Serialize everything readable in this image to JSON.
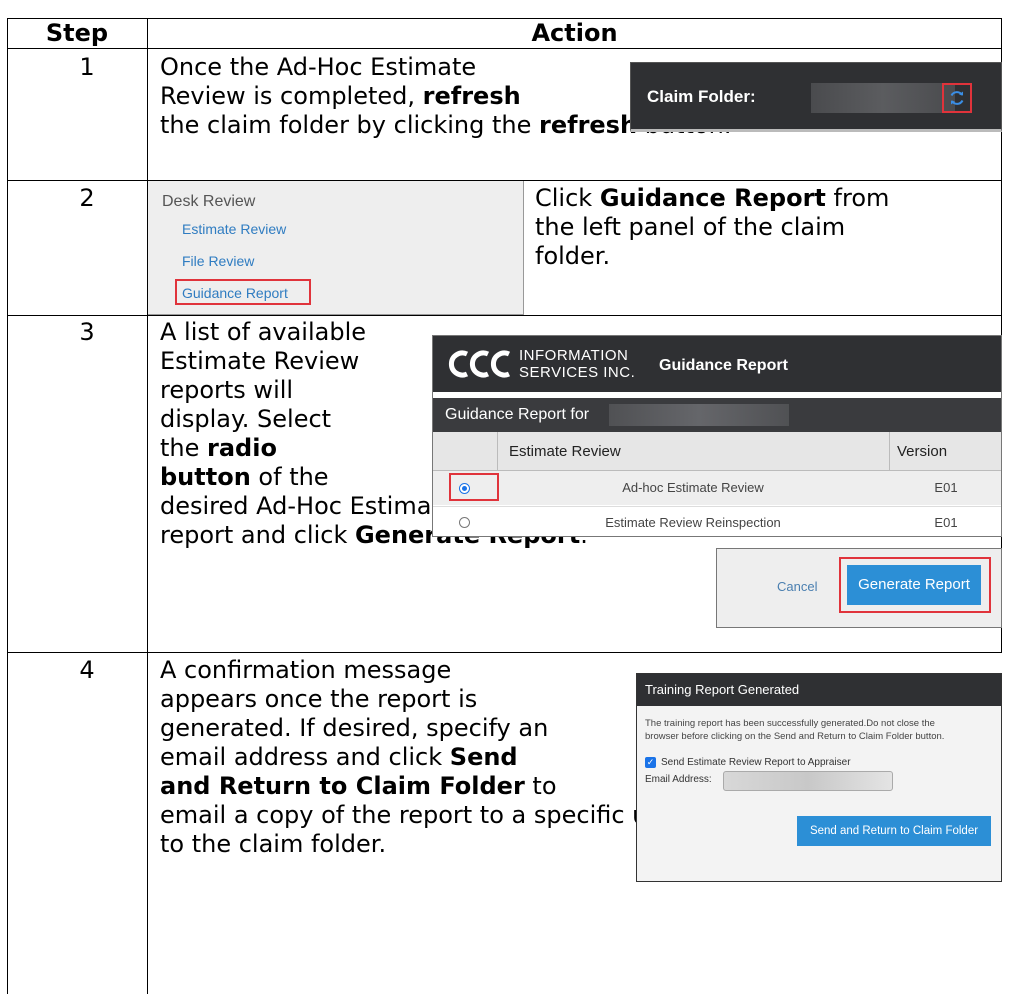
{
  "table": {
    "header": {
      "step": "Step",
      "action": "Action"
    },
    "rows": [
      {
        "num": "1",
        "lines": [
          [
            "Once the Ad-Hoc Estimate"
          ],
          [
            "Review is completed, ",
            {
              "b": "refresh"
            }
          ],
          [
            "the claim folder by clicking the ",
            {
              "b": "refresh"
            },
            " button."
          ]
        ],
        "shot": {
          "label": "Claim Folder:",
          "icon": "refresh-icon"
        }
      },
      {
        "num": "2",
        "lines": [
          [
            "Click ",
            {
              "b": "Guidance Report"
            },
            " from"
          ],
          [
            "the left panel of the claim"
          ],
          [
            "folder."
          ]
        ],
        "shot": {
          "heading": "Desk Review",
          "links": [
            "Estimate Review",
            "File Review",
            "Guidance Report"
          ]
        }
      },
      {
        "num": "3",
        "lines": [
          [
            "A list of available"
          ],
          [
            "Estimate Review"
          ],
          [
            "reports will"
          ],
          [
            "display. Select"
          ],
          [
            "the ",
            {
              "b": "radio"
            }
          ],
          [
            {
              "b": "button"
            },
            " of the"
          ],
          [
            "desired Ad-Hoc Estimate Review"
          ],
          [
            "report and click ",
            {
              "b": "Generate Report"
            },
            "."
          ]
        ],
        "shot": {
          "logo": "CCC",
          "logo_line1": "INFORMATION",
          "logo_line2": "SERVICES INC.",
          "title": "Guidance Report",
          "subheader": "Guidance Report for",
          "col_estimate": "Estimate Review",
          "col_version": "Version",
          "items": [
            {
              "name": "Ad-hoc Estimate Review",
              "version": "E01",
              "selected": true
            },
            {
              "name": "Estimate Review Reinspection",
              "version": "E01",
              "selected": false
            }
          ],
          "cancel": "Cancel",
          "generate": "Generate Report"
        }
      },
      {
        "num": "4",
        "lines": [
          [
            "A confirmation message"
          ],
          [
            "appears once the report is"
          ],
          [
            "generated. If desired, specify an"
          ],
          [
            "email address and click ",
            {
              "b": "Send"
            }
          ],
          [
            {
              "b": "and Return to Claim Folder"
            },
            " to"
          ],
          [
            "email a copy of the report to a specific user and then return"
          ],
          [
            "to the claim folder."
          ]
        ],
        "shot": {
          "title": "Training Report Generated",
          "message_line1": "The training report has been successfully generated.Do not close the",
          "message_line2": "browser before clicking on the Send and Return to Claim Folder button.",
          "checkbox_label": "Send Estimate Review Report to Appraiser",
          "email_label": "Email Address:",
          "button": "Send and Return to Claim Folder"
        }
      }
    ]
  },
  "colors": {
    "accent": "#1a73e8",
    "highlight": "#e0333b",
    "dark_bar": "#2f3033",
    "button_blue": "#2c8fd6"
  }
}
